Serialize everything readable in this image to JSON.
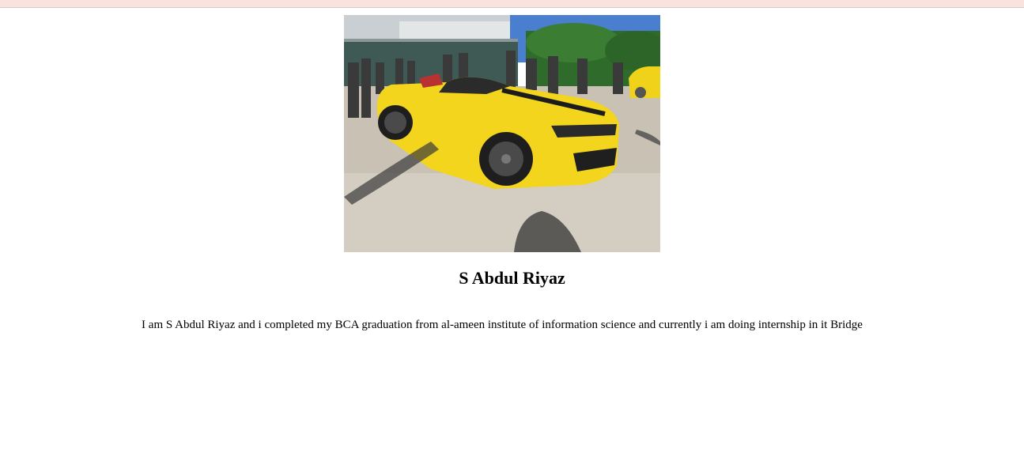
{
  "page": {
    "top_bar_color": "#f8e3de"
  },
  "profile": {
    "photo_subject": "yellow convertible sports car in a parking lot with people in background",
    "photo_alt": "",
    "name": "S Abdul Riyaz",
    "bio": "I am S Abdul Riyaz and i completed my BCA graduation from al-ameen institute of information science and currently i am doing internship in it Bridge"
  }
}
